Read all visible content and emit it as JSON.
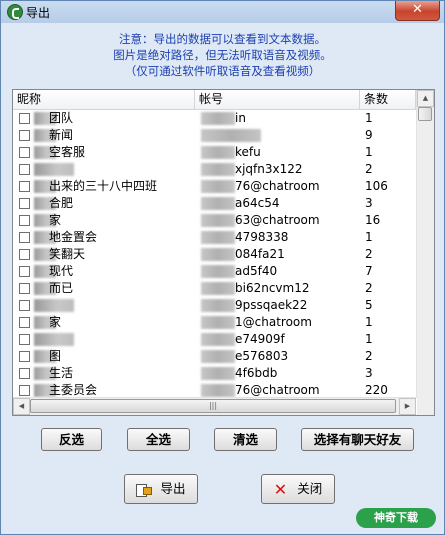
{
  "window": {
    "title": "导出",
    "close_glyph": "✕"
  },
  "notice": {
    "line1": "注意：导出的数据可以查看到文本数据。",
    "line2": "图片是绝对路径，但无法听取语音及视频。",
    "line3": "（仅可通过软件听取语音及查看视频）"
  },
  "list": {
    "headers": {
      "name": "昵称",
      "account": "帐号",
      "count": "条数"
    },
    "rows": [
      {
        "name": "团队",
        "account": "in",
        "count": "1"
      },
      {
        "name": "新闻",
        "account": "",
        "count": "9"
      },
      {
        "name": "空客服",
        "account": "kefu",
        "count": "1"
      },
      {
        "name": "",
        "account": "xjqfn3x122",
        "count": "2"
      },
      {
        "name": "出来的三十八中四班",
        "account": "76@chatroom",
        "count": "106"
      },
      {
        "name": "合肥",
        "account": "a64c54",
        "count": "3"
      },
      {
        "name": "家",
        "account": "63@chatroom",
        "count": "16"
      },
      {
        "name": "地金置会",
        "account": "4798338",
        "count": "1"
      },
      {
        "name": "笑翻天",
        "account": "084fa21",
        "count": "2"
      },
      {
        "name": "现代",
        "account": "ad5f40",
        "count": "7"
      },
      {
        "name": "而已",
        "account": "bi62ncvm12",
        "count": "2"
      },
      {
        "name": "",
        "account": "9pssqaek22",
        "count": "5"
      },
      {
        "name": "家",
        "account": "1@chatroom",
        "count": "1"
      },
      {
        "name": "",
        "account": "e74909f",
        "count": "1"
      },
      {
        "name": "图",
        "account": "e576803",
        "count": "2"
      },
      {
        "name": "生活",
        "account": "4f6bdb",
        "count": "3"
      },
      {
        "name": "主委员会",
        "account": "76@chatroom",
        "count": "220"
      }
    ]
  },
  "buttons": {
    "invert": "反选",
    "select_all": "全选",
    "clear": "清选",
    "select_chatted": "选择有聊天好友",
    "export": "导出",
    "close": "关闭"
  },
  "watermark": "神奇下载",
  "icons": {
    "app": "app-logo-icon",
    "export": "export-icon",
    "close": "red-x-icon",
    "scroll_up": "scroll-up-arrow-icon",
    "scroll_left": "scroll-left-arrow-icon",
    "scroll_right": "scroll-right-arrow-icon"
  }
}
